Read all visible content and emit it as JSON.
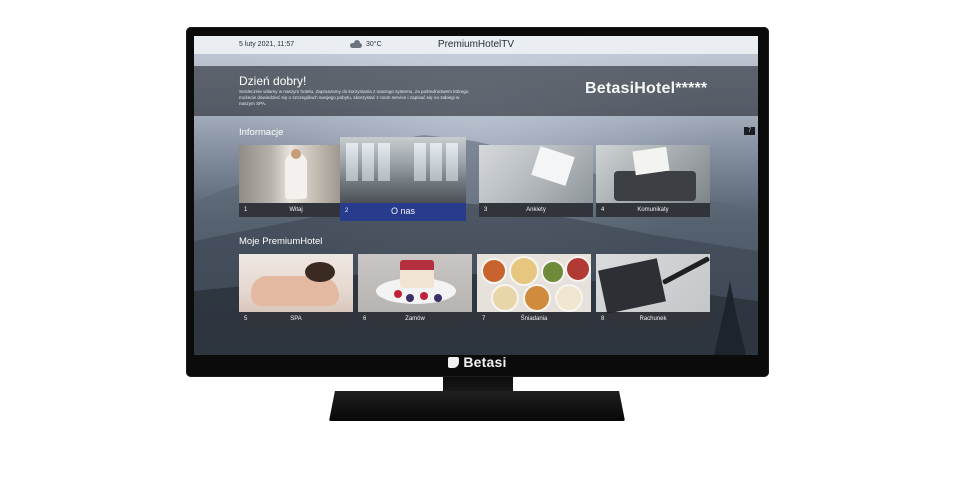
{
  "topbar": {
    "date": "5 luty 2021, 11:57",
    "temperature": "30°C",
    "weather_icon": "cloud-sun-icon",
    "brand": "PremiumHotelTV"
  },
  "welcome": {
    "greeting": "Dzień dobry!",
    "text": "Serdecznie witamy w naszym hotelu. Zapraszamy do korzystania z naszego systemu, za pośrednictwem którego możecie dowiedzieć się o szczegółach swojego pobytu, skorzystać z room service i zapisać się na zabiegi w naszym SPA.",
    "hotel_name": "BetasiHotel*****"
  },
  "side_tag": "7",
  "sections": {
    "informacje": {
      "title": "Informacje",
      "tiles": [
        {
          "num": "1",
          "label": "Witaj"
        },
        {
          "num": "2",
          "label": "O nas"
        },
        {
          "num": "3",
          "label": "Ankiety"
        },
        {
          "num": "4",
          "label": "Komunikaty"
        }
      ]
    },
    "moje": {
      "title": "Moje PremiumHotel",
      "tiles": [
        {
          "num": "5",
          "label": "SPA"
        },
        {
          "num": "6",
          "label": "Zamów"
        },
        {
          "num": "7",
          "label": "Śniadania"
        },
        {
          "num": "8",
          "label": "Rachunek"
        }
      ]
    }
  },
  "tv_brand": "Betasi",
  "colors": {
    "active_tile": "#283b8c",
    "tile_label_bg": "#1e222a"
  }
}
